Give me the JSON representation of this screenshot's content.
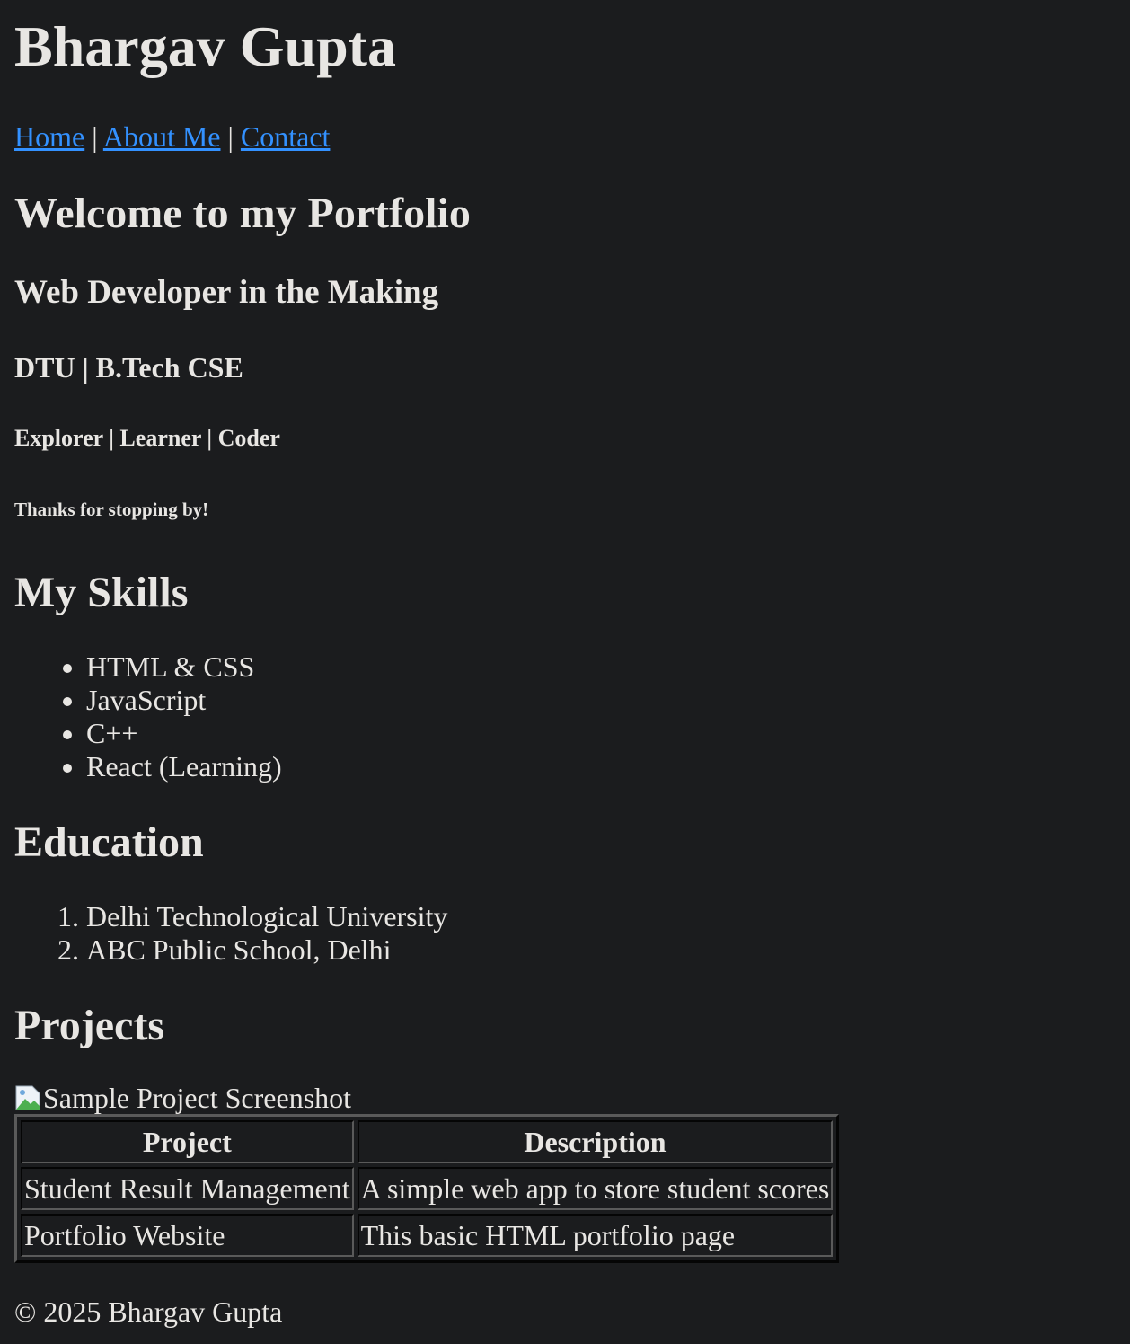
{
  "header": {
    "title": "Bhargav Gupta"
  },
  "nav": {
    "home": "Home",
    "about": "About Me",
    "contact": "Contact",
    "separator": "|"
  },
  "intro": {
    "welcome": "Welcome to my Portfolio",
    "subtitle": "Web Developer in the Making",
    "education_line": "DTU | B.Tech CSE",
    "roles": "Explorer | Learner | Coder",
    "thanks": "Thanks for stopping by!"
  },
  "skills": {
    "title": "My Skills",
    "items": [
      "HTML & CSS",
      "JavaScript",
      "C++",
      "React (Learning)"
    ]
  },
  "education": {
    "title": "Education",
    "items": [
      "Delhi Technological University",
      "ABC Public School, Delhi"
    ]
  },
  "projects": {
    "title": "Projects",
    "image_alt": "Sample Project Screenshot",
    "headers": [
      "Project",
      "Description"
    ],
    "rows": [
      [
        "Student Result Management",
        "A simple web app to store student scores"
      ],
      [
        "Portfolio Website",
        "This basic HTML portfolio page"
      ]
    ]
  },
  "footer": {
    "text": "© 2025 Bhargav Gupta"
  },
  "colors": {
    "background": "#1b1c1e",
    "text": "#e8e6e3",
    "link": "#3391ff"
  }
}
